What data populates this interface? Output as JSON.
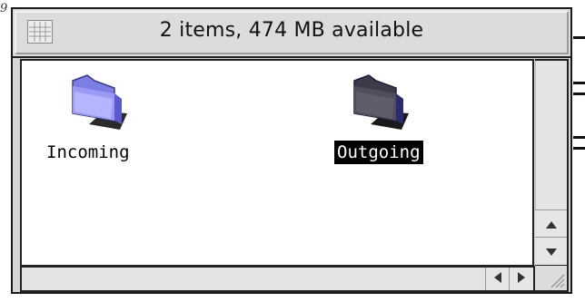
{
  "edge_text": "9",
  "window": {
    "status_text": "2 items, 474 MB available",
    "view_icon": "grid-view-icon"
  },
  "items": [
    {
      "label": "Incoming",
      "icon": "folder-icon",
      "selected": false
    },
    {
      "label": "Outgoing",
      "icon": "folder-icon",
      "selected": true
    }
  ],
  "scrollbars": {
    "up_icon": "scroll-up-arrow-icon",
    "down_icon": "scroll-down-arrow-icon",
    "left_icon": "scroll-left-arrow-icon",
    "right_icon": "scroll-right-arrow-icon",
    "grow_icon": "resize-grip-icon"
  },
  "colors": {
    "folder_normal": "#8f8ff0",
    "folder_selected": "#4a4a5a",
    "selection_bg": "#000000"
  }
}
